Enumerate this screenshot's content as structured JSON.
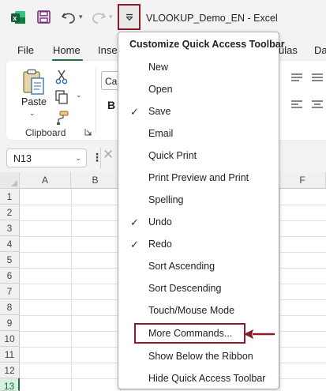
{
  "titlebar": {
    "document_title": "VLOOKUP_Demo_EN  -  Excel"
  },
  "tabs": {
    "file": "File",
    "home": "Home",
    "insert": "Inser",
    "formulas": "ulas",
    "data": "Dat"
  },
  "ribbon": {
    "paste_label": "Paste",
    "clipboard_label": "Clipboard",
    "font_name": "Cali",
    "bold_label": "B"
  },
  "formula_bar": {
    "name_box_value": "N13"
  },
  "grid": {
    "columns": [
      "A",
      "B",
      "F"
    ],
    "rows": [
      "1",
      "2",
      "3",
      "4",
      "5",
      "6",
      "7",
      "8",
      "9",
      "10",
      "11",
      "12",
      "13"
    ],
    "active_row": "13"
  },
  "menu": {
    "title": "Customize Quick Access Toolbar",
    "items": [
      {
        "label": "New",
        "checked": false
      },
      {
        "label": "Open",
        "checked": false
      },
      {
        "label": "Save",
        "checked": true
      },
      {
        "label": "Email",
        "checked": false
      },
      {
        "label": "Quick Print",
        "checked": false
      },
      {
        "label": "Print Preview and Print",
        "checked": false
      },
      {
        "label": "Spelling",
        "checked": false
      },
      {
        "label": "Undo",
        "checked": true
      },
      {
        "label": "Redo",
        "checked": true
      },
      {
        "label": "Sort Ascending",
        "checked": false
      },
      {
        "label": "Sort Descending",
        "checked": false
      },
      {
        "label": "Touch/Mouse Mode",
        "checked": false
      },
      {
        "label": "More Commands...",
        "checked": false,
        "highlighted": true
      },
      {
        "label": "Show Below the Ribbon",
        "checked": false
      },
      {
        "label": "Hide Quick Access Toolbar",
        "checked": false
      }
    ]
  },
  "icons": {
    "excel_logo": "excel-logo-icon",
    "save": "save-icon",
    "undo": "undo-icon",
    "redo": "redo-icon",
    "customize": "customize-qat-icon",
    "check": "checkmark-icon",
    "arrow": "arrow-left-icon"
  },
  "colors": {
    "excel_green": "#217346",
    "highlight_red": "#8b1a2b",
    "save_purple": "#7b2a7b"
  }
}
